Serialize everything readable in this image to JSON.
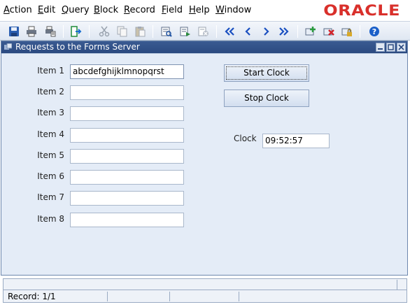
{
  "menu": {
    "items": [
      {
        "first": "A",
        "rest": "ction"
      },
      {
        "first": "E",
        "rest": "dit"
      },
      {
        "first": "Q",
        "rest": "uery"
      },
      {
        "first": "B",
        "rest": "lock"
      },
      {
        "first": "R",
        "rest": "ecord"
      },
      {
        "first": "F",
        "rest": "ield"
      },
      {
        "first": "H",
        "rest": "elp"
      },
      {
        "first": "W",
        "rest": "indow"
      }
    ]
  },
  "brand": {
    "logo_text": "ORACLE",
    "color": "#d9302b"
  },
  "toolbar": {
    "icons": [
      "save-icon",
      "print-icon",
      "print-setup-icon",
      "exit-icon",
      "cut-icon",
      "copy-icon",
      "paste-icon",
      "enter-query-icon",
      "execute-query-icon",
      "cancel-query-icon",
      "first-record-icon",
      "previous-record-icon",
      "next-record-icon",
      "last-record-icon",
      "insert-record-icon",
      "delete-record-icon",
      "lock-record-icon",
      "help-icon"
    ]
  },
  "window": {
    "title": "Requests to the Forms Server"
  },
  "form": {
    "items": [
      {
        "label": "Item 1",
        "value": "abcdefghijklmnopqrst"
      },
      {
        "label": "Item 2",
        "value": ""
      },
      {
        "label": "Item 3",
        "value": ""
      },
      {
        "label": "Item 4",
        "value": ""
      },
      {
        "label": "Item 5",
        "value": ""
      },
      {
        "label": "Item 6",
        "value": ""
      },
      {
        "label": "Item 7",
        "value": ""
      },
      {
        "label": "Item 8",
        "value": ""
      }
    ],
    "start_clock_label": "Start Clock",
    "stop_clock_label": "Stop Clock",
    "clock_label": "Clock",
    "clock_value": "09:52:57"
  },
  "status": {
    "record": "Record: 1/1"
  },
  "colors": {
    "title_bar": "#2b4a80",
    "window_bg": "#e4ecf7",
    "toolbar_blue": "#2a5db0"
  }
}
